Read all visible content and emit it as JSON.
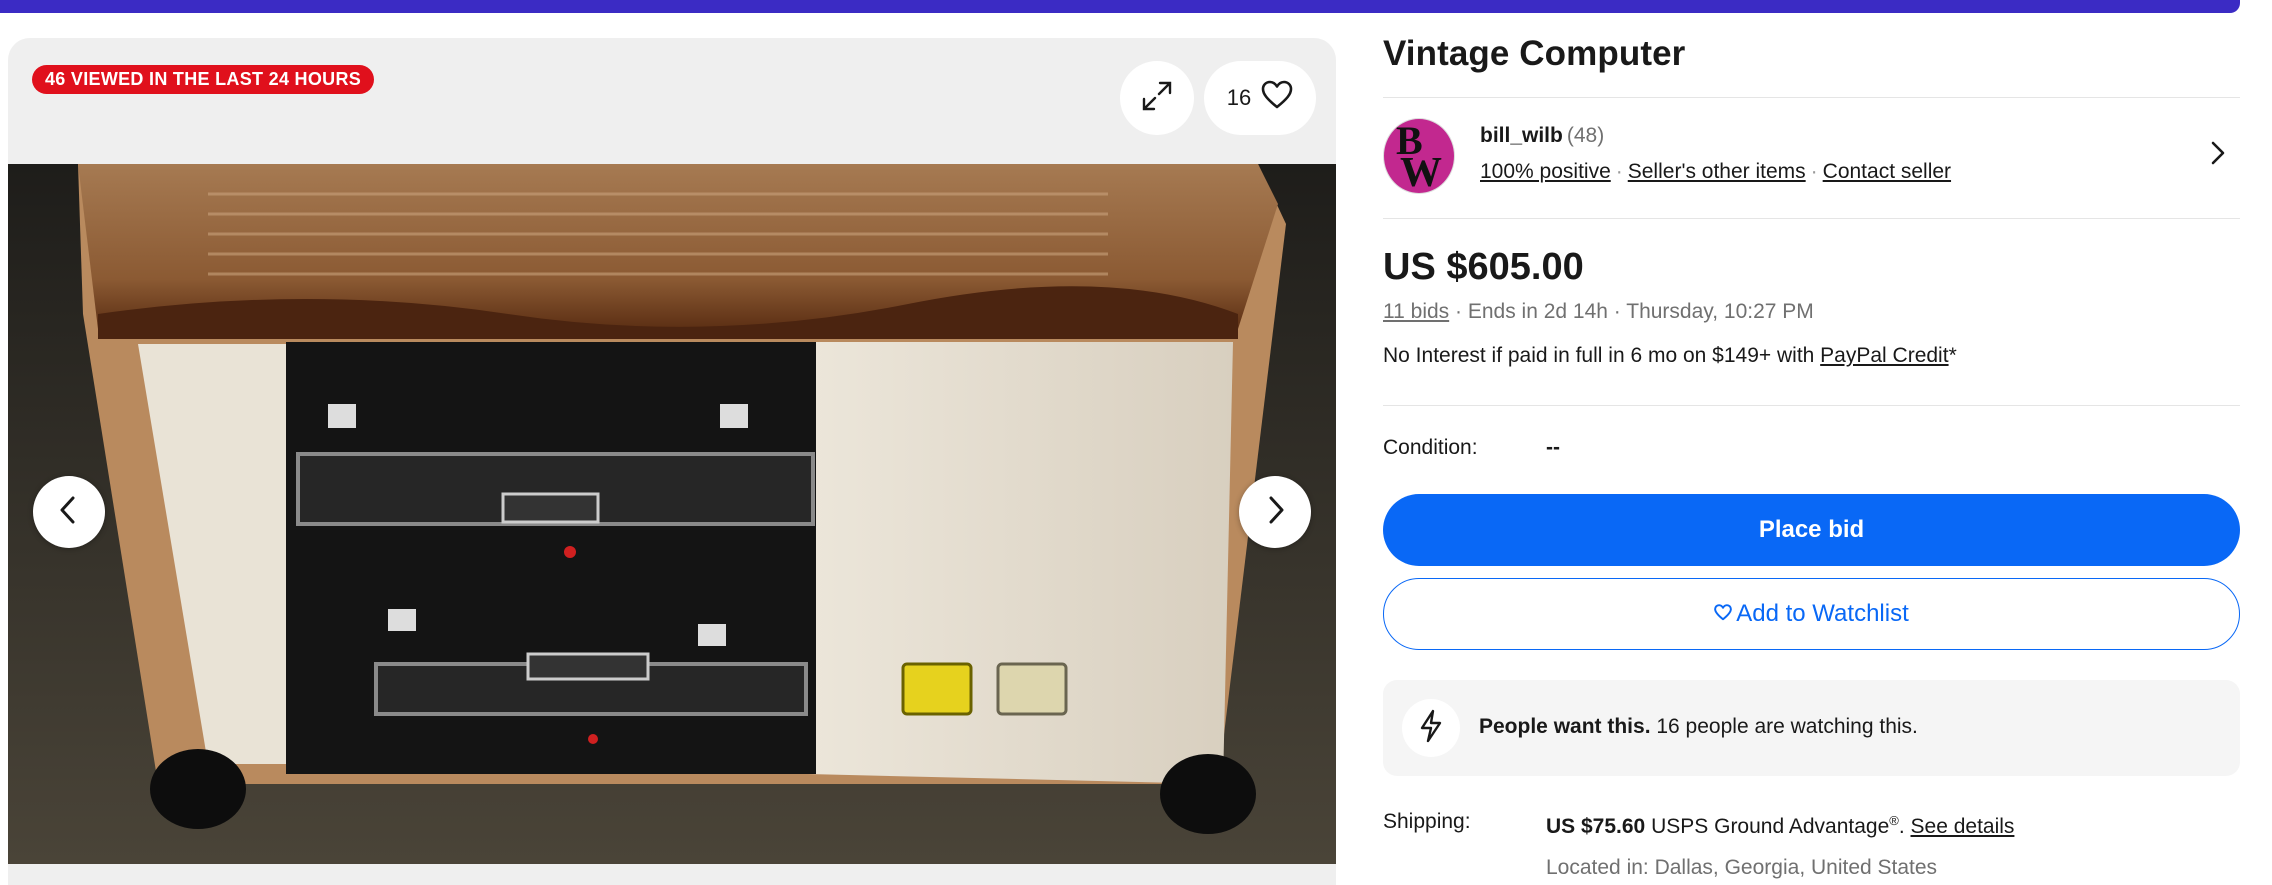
{
  "gallery": {
    "viewed_badge": "46 VIEWED IN THE LAST 24 HOURS",
    "watch_count": "16"
  },
  "listing": {
    "title": "Vintage Computer"
  },
  "seller": {
    "avatar_letters": [
      "B",
      "W"
    ],
    "name": "bill_wilb",
    "feedback_count": "(48)",
    "positive": "100% positive",
    "other_items": "Seller's other items",
    "contact": "Contact seller"
  },
  "price": {
    "amount": "US $605.00",
    "bids": "11 bids",
    "ends": "Ends in 2d 14h",
    "end_time": "Thursday, 10:27 PM",
    "credit_text": "No Interest if paid in full in 6 mo on $149+ with ",
    "credit_link": "PayPal Credit",
    "credit_suffix": "*"
  },
  "condition": {
    "label": "Condition:",
    "value": "--"
  },
  "actions": {
    "place_bid": "Place bid",
    "add_watchlist": "Add to Watchlist"
  },
  "signal": {
    "bold": "People want this.",
    "text": " 16 people are watching this."
  },
  "shipping": {
    "label": "Shipping:",
    "price": "US $75.60",
    "service": " USPS Ground Advantage",
    "reg": "®",
    "period": ". ",
    "see_details": "See details",
    "located": "Located in: Dallas, Georgia, United States"
  },
  "colors": {
    "brand_bar": "#3b2bc4",
    "accent_blue": "#0968f6",
    "badge_red": "#e0101c"
  }
}
